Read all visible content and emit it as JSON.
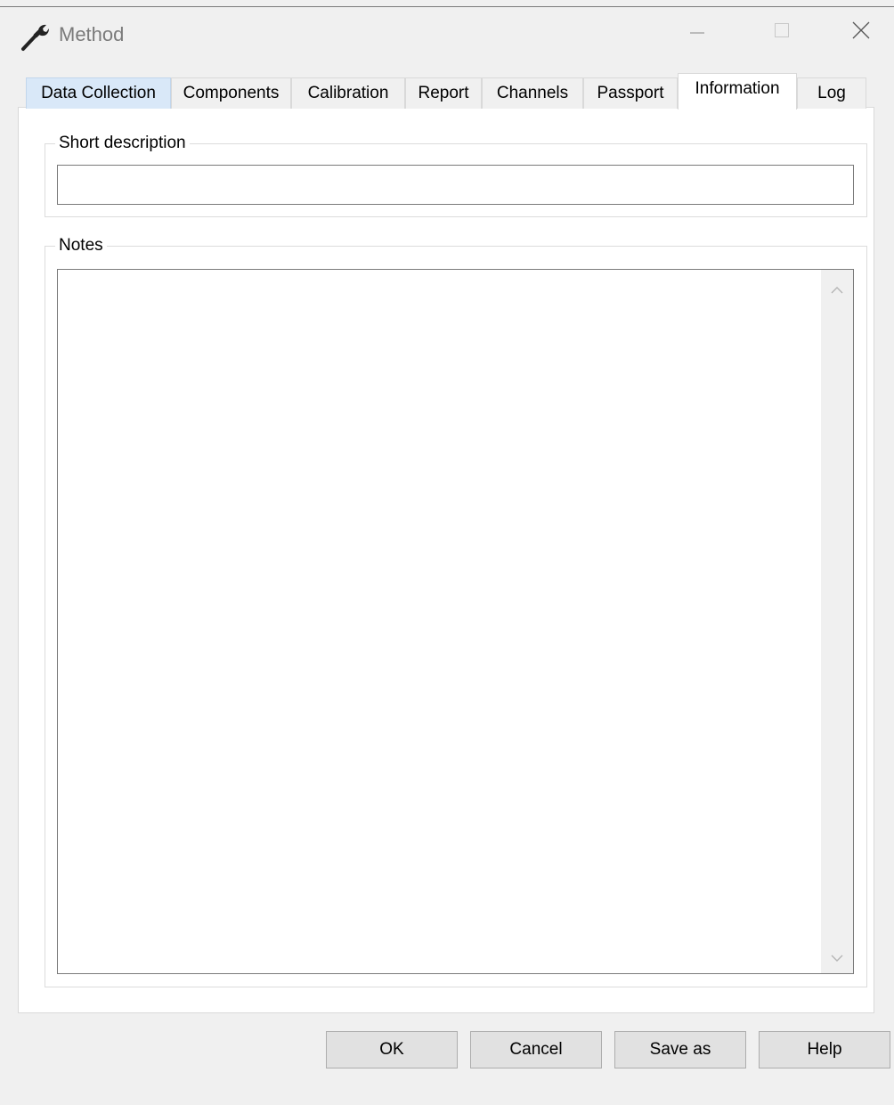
{
  "window": {
    "title": "Method",
    "icon": "wrench-icon",
    "controls": [
      "minimize-icon",
      "maximize-icon",
      "close-icon"
    ]
  },
  "tabs": [
    {
      "label": "Data Collection"
    },
    {
      "label": "Components"
    },
    {
      "label": "Calibration"
    },
    {
      "label": "Report"
    },
    {
      "label": "Channels"
    },
    {
      "label": "Passport"
    },
    {
      "label": "Information",
      "active": true
    },
    {
      "label": "Log"
    }
  ],
  "short_description": {
    "legend": "Short description",
    "value": ""
  },
  "notes": {
    "legend": "Notes",
    "value": ""
  },
  "buttons": {
    "ok": "OK",
    "cancel": "Cancel",
    "save_as": "Save as",
    "help": "Help"
  },
  "colors": {
    "tab_highlight": "#d9e8f8",
    "title_text": "#7a7a7a",
    "button_face": "#e1e1e1"
  }
}
